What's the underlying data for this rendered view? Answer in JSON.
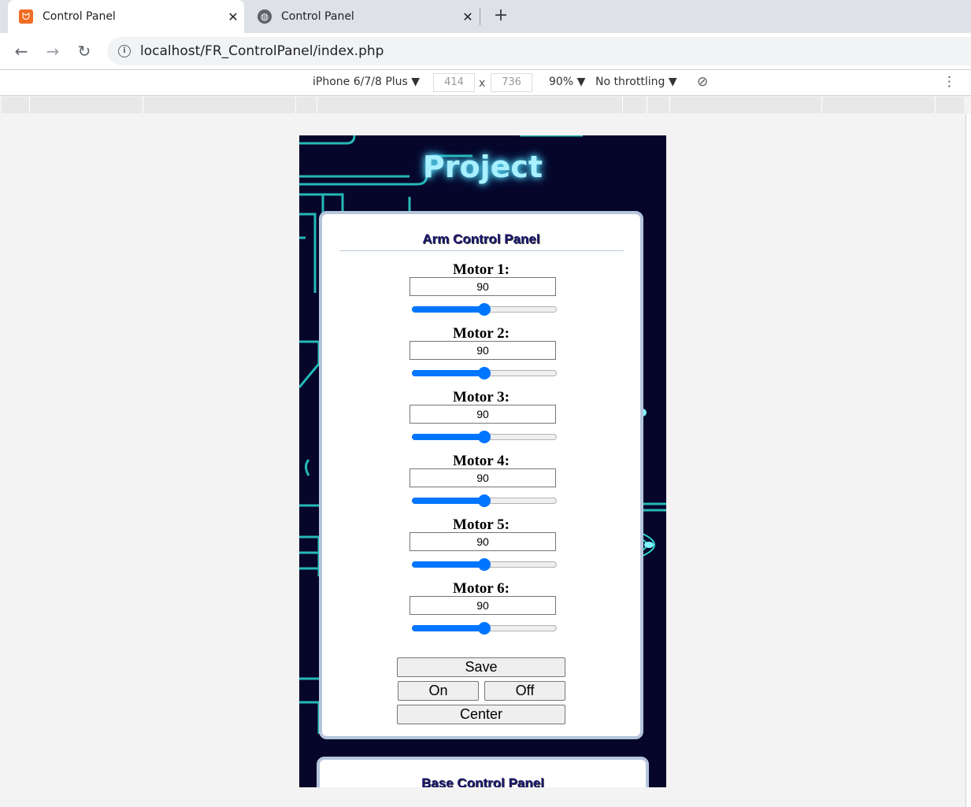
{
  "browser": {
    "tabs": [
      {
        "title": "Control Panel",
        "icon": "xampp-icon",
        "active": true
      },
      {
        "title": "Control Panel",
        "icon": "globe-icon",
        "active": false
      }
    ],
    "close_glyph": "✕",
    "new_tab_glyph": "+",
    "url": "localhost/FR_ControlPanel/index.php"
  },
  "devtools": {
    "device": "iPhone 6/7/8 Plus ▼",
    "width": "414",
    "times": "x",
    "height": "736",
    "zoom": "90% ▼",
    "throttling": "No throttling ▼"
  },
  "page": {
    "hero_title": "Project",
    "arm_panel": {
      "title": "Arm Control Panel",
      "motors": [
        {
          "label": "Motor 1:",
          "value": "90",
          "slider_fraction": 0.5
        },
        {
          "label": "Motor 2:",
          "value": "90",
          "slider_fraction": 0.5
        },
        {
          "label": "Motor 3:",
          "value": "90",
          "slider_fraction": 0.5
        },
        {
          "label": "Motor 4:",
          "value": "90",
          "slider_fraction": 0.5
        },
        {
          "label": "Motor 5:",
          "value": "90",
          "slider_fraction": 0.5
        },
        {
          "label": "Motor 6:",
          "value": "90",
          "slider_fraction": 0.5
        }
      ],
      "buttons": {
        "save": "Save",
        "on": "On",
        "off": "Off",
        "center": "Center"
      }
    },
    "base_panel": {
      "title": "Base Control Panel"
    }
  },
  "colors": {
    "slider_accent": "#0075ff",
    "page_background": "#06052a",
    "hero_glow": "#5fe3ff"
  }
}
